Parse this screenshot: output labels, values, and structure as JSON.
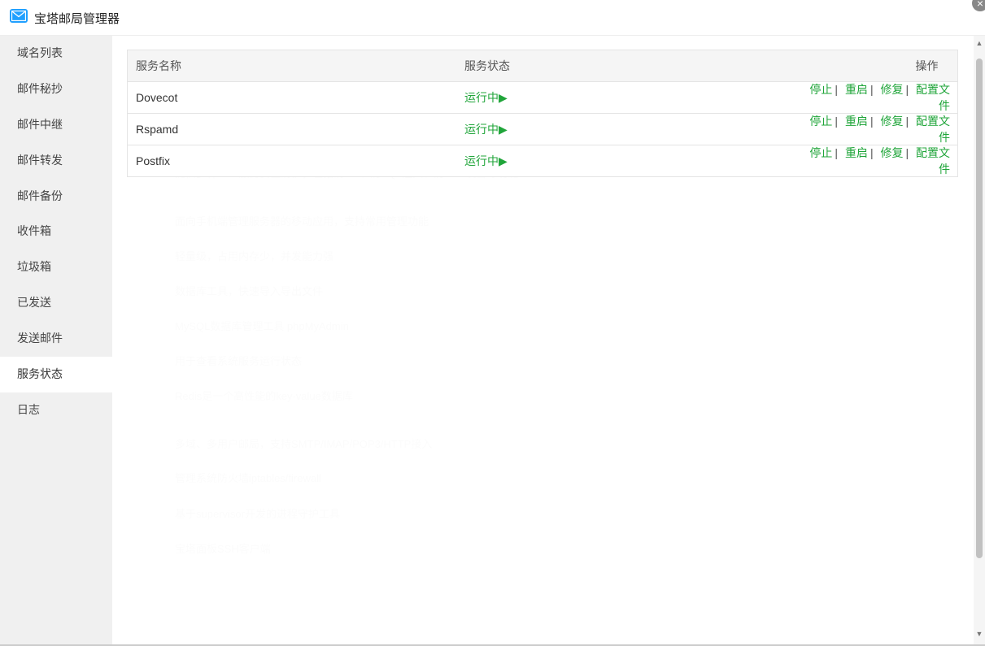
{
  "window": {
    "title": "宝塔邮局管理器",
    "close_icon": "×"
  },
  "sidebar": {
    "items": [
      {
        "label": "域名列表"
      },
      {
        "label": "邮件秘抄"
      },
      {
        "label": "邮件中继"
      },
      {
        "label": "邮件转发"
      },
      {
        "label": "邮件备份"
      },
      {
        "label": "收件箱"
      },
      {
        "label": "垃圾箱"
      },
      {
        "label": "已发送"
      },
      {
        "label": "发送邮件"
      },
      {
        "label": "服务状态"
      },
      {
        "label": "日志"
      }
    ],
    "active_index": 9
  },
  "table": {
    "headers": {
      "name": "服务名称",
      "status": "服务状态",
      "ops": "操作"
    },
    "rows": [
      {
        "name": "Dovecot",
        "status": "运行中▶"
      },
      {
        "name": "Rspamd",
        "status": "运行中▶"
      },
      {
        "name": "Postfix",
        "status": "运行中▶"
      }
    ],
    "ops": {
      "stop": "停止",
      "restart": "重启",
      "repair": "修复",
      "config": "配置文件",
      "sep": "|"
    }
  },
  "colors": {
    "accent": "#20a53a",
    "brand_icon": "#20a0ff",
    "sidebar_bg": "#f0f0f0"
  },
  "scrollbar": {
    "up_icon": "▲",
    "down_icon": "▼"
  }
}
